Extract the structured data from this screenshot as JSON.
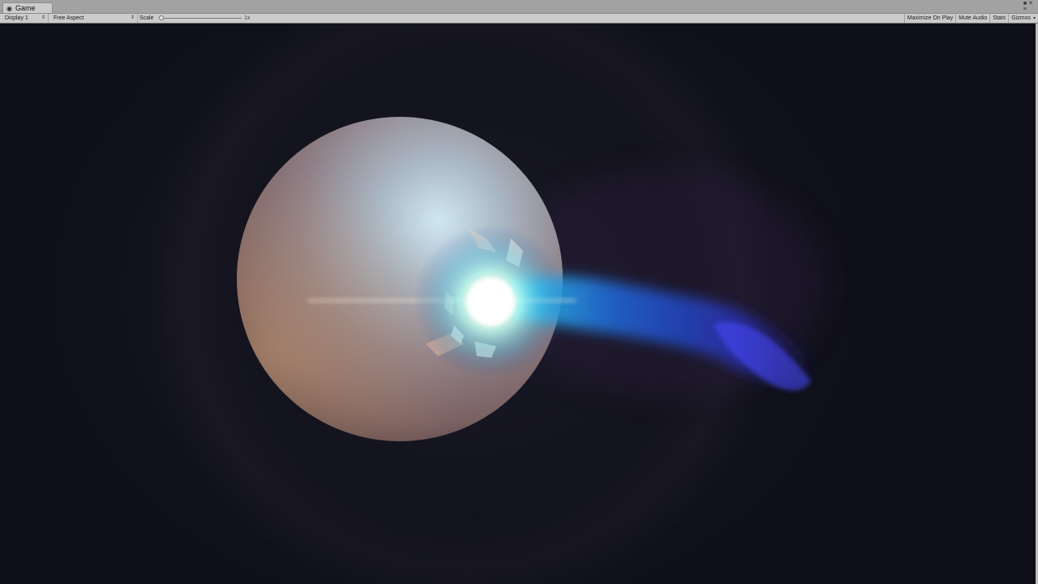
{
  "tab": {
    "label": "Game",
    "icon": "game-controller-icon"
  },
  "window_controls": {
    "icon": "window-menu-icon"
  },
  "toolbar": {
    "display": "Display 1",
    "aspect": "Free Aspect",
    "scale_label": "Scale",
    "scale_value": "1x",
    "buttons": {
      "maximize": "Maximize On Play",
      "mute": "Mute Audio",
      "stats": "Stats",
      "gizmos": "Gizmos"
    }
  },
  "colors": {
    "tab_strip": "#a2a2a2",
    "toolbar": "#cbcbcb",
    "scene_bg": "#0f1019",
    "flash": "#fffbe0",
    "trail": "#2a36d8"
  }
}
